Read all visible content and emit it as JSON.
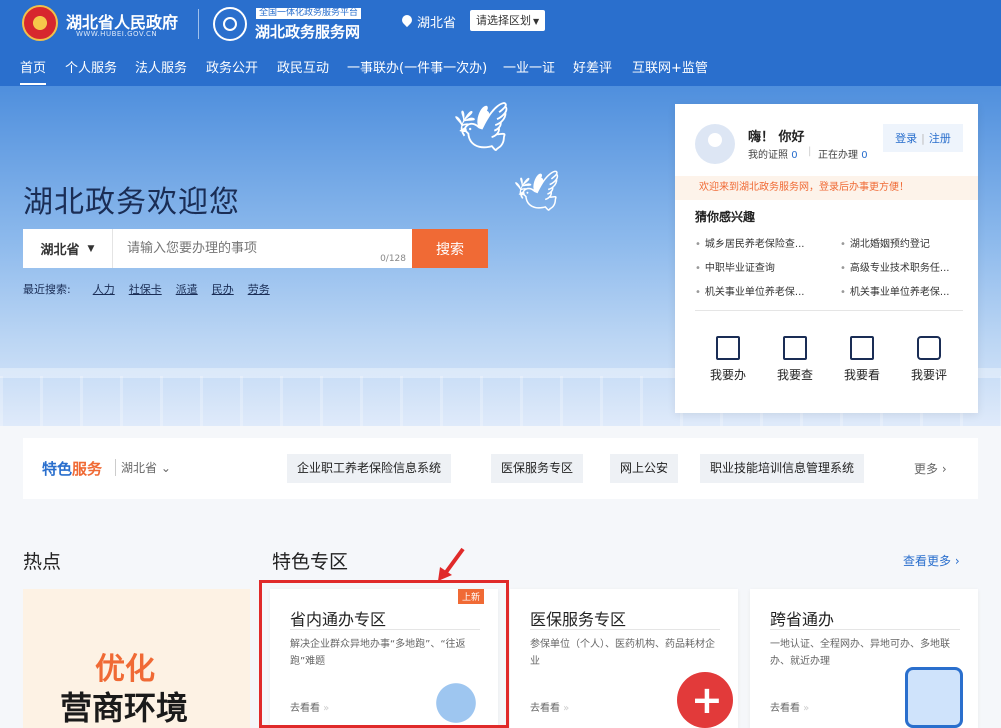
{
  "header": {
    "gov_name": "湖北省人民政府",
    "gov_url": "WWW.HUBEI.GOV.CN",
    "platform_tag": "全国一体化政务服务平台",
    "platform_name": "湖北政务服务网",
    "location": "湖北省",
    "region_select": "请选择区划",
    "region_caret": "▼"
  },
  "nav": [
    "首页",
    "个人服务",
    "法人服务",
    "政务公开",
    "政民互动",
    "一事联办(一件事一次办)",
    "一业一证",
    "好差评",
    "互联网+监管"
  ],
  "hero": {
    "title": "湖北政务欢迎您",
    "province": "湖北省",
    "province_caret": "▼",
    "search_placeholder": "请输入您要办理的事项",
    "counter": "0/128",
    "search_button": "搜索",
    "recent_label": "最近搜索:",
    "recent": [
      "人力",
      "社保卡",
      "派遣",
      "民办",
      "劳务"
    ]
  },
  "user_card": {
    "greeting": "嗨！ 你好",
    "cert_label": "我的证照",
    "cert_count": "0",
    "doing_label": "正在办理",
    "doing_count": "0",
    "login": "登录",
    "divider": "|",
    "register": "注册",
    "notice": "欢迎来到湖北政务服务网，登录后办事更方便！",
    "guess_title": "猜你感兴趣",
    "guess": [
      "城乡居民养老保险查...",
      "湖北婚姻预约登记",
      "中职毕业证查询",
      "高级专业技术职务任...",
      "机关事业单位养老保...",
      "机关事业单位养老保..."
    ],
    "actions": [
      "我要办",
      "我要查",
      "我要看",
      "我要评"
    ]
  },
  "featured": {
    "logo_a": "特色",
    "logo_b": "服务",
    "province": "湖北省",
    "tags": [
      "企业职工养老保险信息系统",
      "医保服务专区",
      "网上公安",
      "职业技能培训信息管理系统"
    ],
    "more": "更多 ›"
  },
  "sections": {
    "hot": "热点",
    "special": "特色专区",
    "see_more": "查看更多 ›"
  },
  "hot_banner": {
    "line1": "优化",
    "line2": "营商环境"
  },
  "cards": [
    {
      "title": "省内通办专区",
      "badge": "上新",
      "desc": "解决企业群众异地办事“多地跑”、“往返跑”难题",
      "go": "去看看"
    },
    {
      "title": "医保服务专区",
      "desc": "参保单位（个人）、医药机构、药品耗材企业",
      "go": "去看看"
    },
    {
      "title": "跨省通办",
      "desc": "一地认证、全程网办、异地可办、多地联办、就近办理",
      "go": "去看看"
    }
  ],
  "colors": {
    "brand": "#2a6fcd",
    "accent": "#f06a35",
    "highlight": "#e02a2a"
  }
}
